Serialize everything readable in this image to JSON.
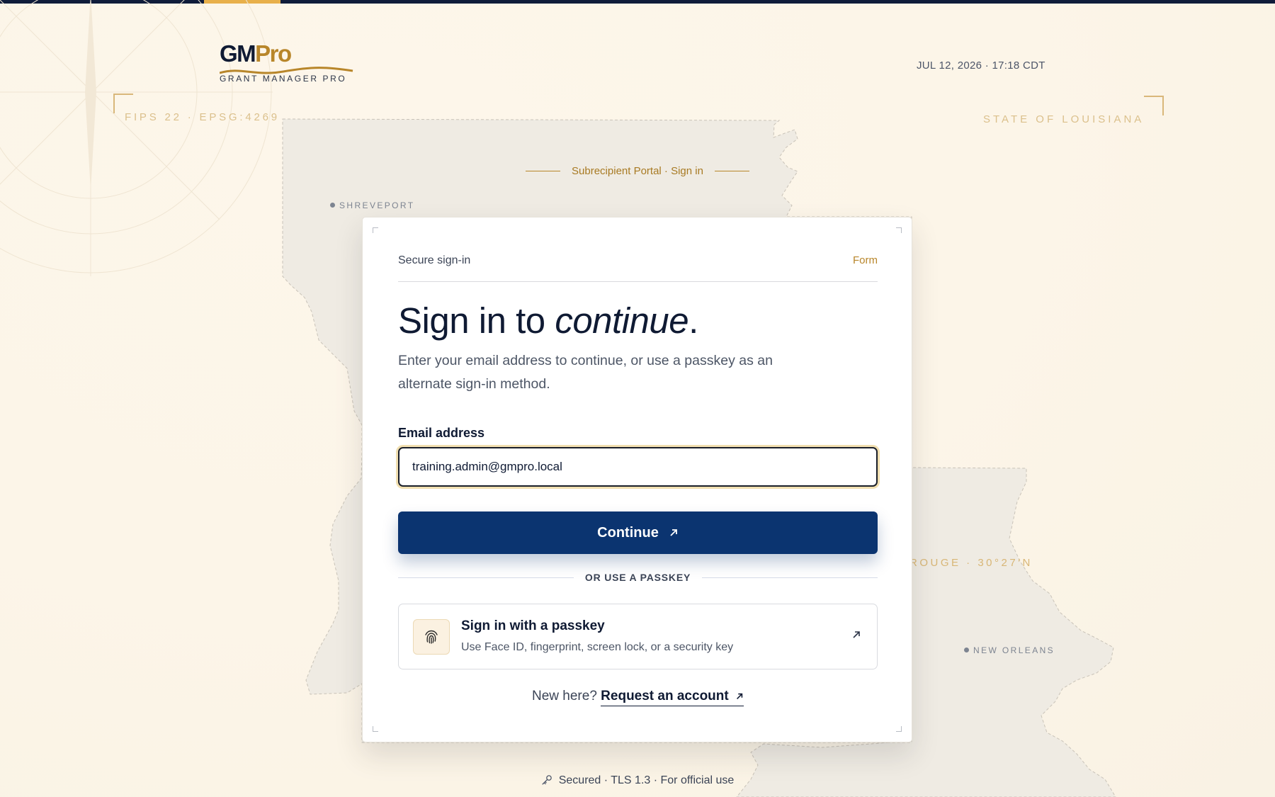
{
  "header": {
    "logo_gm": "GM",
    "logo_pro": "Pro",
    "logo_subtitle": "GRANT MANAGER PRO",
    "timestamp": "JUL 12, 2026 · 17:18 CDT"
  },
  "map": {
    "coord_left": "FIPS 22 · EPSG:4269",
    "coord_right": "STATE OF LOUISIANA",
    "coord_bottom_right": "ROUGE · 30°27′N",
    "city_1": "SHREVEPORT",
    "city_2": "NEW ORLEANS"
  },
  "portal_label": "Subrecipient Portal · Sign in",
  "card": {
    "header_left": "Secure sign-in",
    "header_right": "Form",
    "title_plain": "Sign in to ",
    "title_italic": "continue",
    "title_end": ".",
    "subtitle": "Enter your email address to continue, or use a passkey as an alternate sign-in method.",
    "email_label": "Email address",
    "email_value": "training.admin@gmpro.local",
    "continue_label": "Continue",
    "divider_text": "OR USE A PASSKEY",
    "passkey_title": "Sign in with a passkey",
    "passkey_desc": "Use Face ID, fingerprint, screen lock, or a security key",
    "new_here": "New here?",
    "request_account": "Request an account"
  },
  "footer": "Secured · TLS 1.3 · For official use",
  "colors": {
    "primary": "#0b3470",
    "accent": "#b8862a",
    "topbar": "#0f1c3a",
    "topbar_accent": "#e8b04a"
  },
  "icons": {
    "passkey": "fingerprint-icon",
    "arrow": "arrow-up-right-icon",
    "footer": "key-icon"
  }
}
